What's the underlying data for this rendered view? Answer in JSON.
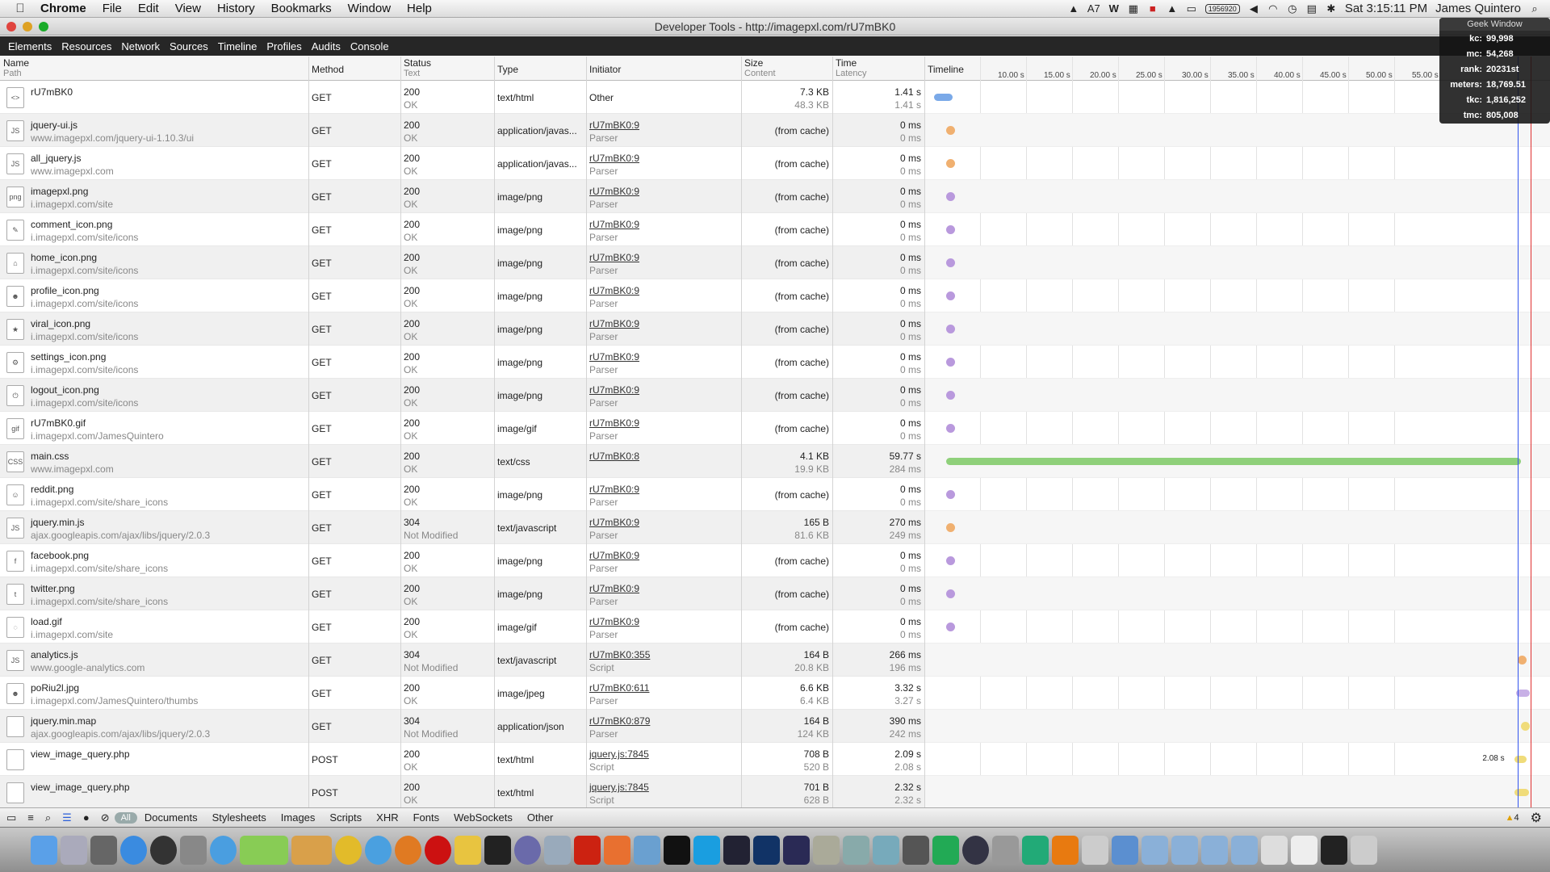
{
  "menubar": {
    "items": [
      "Chrome",
      "File",
      "Edit",
      "View",
      "History",
      "Bookmarks",
      "Window",
      "Help"
    ],
    "status": {
      "a_label": "7",
      "counter": "1956920",
      "datetime": "Sat 3:15:11 PM",
      "user": "James Quintero"
    }
  },
  "window": {
    "title": "Developer Tools - http://imagepxl.com/rU7mBK0"
  },
  "toolbar": {
    "tabs": [
      "Elements",
      "Resources",
      "Network",
      "Sources",
      "Timeline",
      "Profiles",
      "Audits",
      "Console"
    ]
  },
  "geek": {
    "title": "Geek Window",
    "rows": [
      {
        "k": "kc:",
        "v": "99,998"
      },
      {
        "k": "mc:",
        "v": "54,268"
      },
      {
        "k": "rank:",
        "v": "20231st"
      },
      {
        "k": "meters:",
        "v": "18,769.51"
      },
      {
        "k": "tkc:",
        "v": "1,816,252"
      },
      {
        "k": "tmc:",
        "v": "805,008"
      }
    ]
  },
  "columns": {
    "name": "Name",
    "name_sub": "Path",
    "method": "Method",
    "status": "Status",
    "status_sub": "Text",
    "type": "Type",
    "initiator": "Initiator",
    "size": "Size",
    "size_sub": "Content",
    "time": "Time",
    "time_sub": "Latency",
    "timeline": "Timeline"
  },
  "timeline_ticks": [
    "10.00 s",
    "15.00 s",
    "20.00 s",
    "25.00 s",
    "30.00 s",
    "35.00 s",
    "40.00 s",
    "45.00 s",
    "50.00 s",
    "55.00 s"
  ],
  "rows": [
    {
      "name": "rU7mBK0",
      "path": "",
      "method": "GET",
      "status": "200",
      "status_text": "OK",
      "type": "text/html",
      "initiator": "Other",
      "initiator_sub": "",
      "size": "7.3 KB",
      "content": "48.3 KB",
      "time": "1.41 s",
      "latency": "1.41 s",
      "icon": "html-file-icon",
      "icon_text": "<>",
      "bar": {
        "start": 0.01,
        "end": 0.04,
        "color": "#7aa9e8"
      }
    },
    {
      "name": "jquery-ui.js",
      "path": "www.imagepxl.com/jquery-ui-1.10.3/ui",
      "method": "GET",
      "status": "200",
      "status_text": "OK",
      "type": "application/javas...",
      "initiator": "rU7mBK0:9",
      "initiator_sub": "Parser",
      "size": "(from cache)",
      "content": "",
      "time": "0 ms",
      "latency": "0 ms",
      "icon": "js-file-icon",
      "icon_text": "JS",
      "dot": {
        "at": 0.03,
        "color": "#f0b070"
      }
    },
    {
      "name": "all_jquery.js",
      "path": "www.imagepxl.com",
      "method": "GET",
      "status": "200",
      "status_text": "OK",
      "type": "application/javas...",
      "initiator": "rU7mBK0:9",
      "initiator_sub": "Parser",
      "size": "(from cache)",
      "content": "",
      "time": "0 ms",
      "latency": "0 ms",
      "icon": "js-file-icon",
      "icon_text": "JS",
      "dot": {
        "at": 0.03,
        "color": "#f0b070"
      }
    },
    {
      "name": "imagepxl.png",
      "path": "i.imagepxl.com/site",
      "method": "GET",
      "status": "200",
      "status_text": "OK",
      "type": "image/png",
      "initiator": "rU7mBK0:9",
      "initiator_sub": "Parser",
      "size": "(from cache)",
      "content": "",
      "time": "0 ms",
      "latency": "0 ms",
      "icon": "png-file-icon",
      "icon_text": "png",
      "dot": {
        "at": 0.03,
        "color": "#b999dd"
      }
    },
    {
      "name": "comment_icon.png",
      "path": "i.imagepxl.com/site/icons",
      "method": "GET",
      "status": "200",
      "status_text": "OK",
      "type": "image/png",
      "initiator": "rU7mBK0:9",
      "initiator_sub": "Parser",
      "size": "(from cache)",
      "content": "",
      "time": "0 ms",
      "latency": "0 ms",
      "icon": "comment-icon",
      "icon_text": "✎",
      "dot": {
        "at": 0.03,
        "color": "#b999dd"
      }
    },
    {
      "name": "home_icon.png",
      "path": "i.imagepxl.com/site/icons",
      "method": "GET",
      "status": "200",
      "status_text": "OK",
      "type": "image/png",
      "initiator": "rU7mBK0:9",
      "initiator_sub": "Parser",
      "size": "(from cache)",
      "content": "",
      "time": "0 ms",
      "latency": "0 ms",
      "icon": "home-icon",
      "icon_text": "⌂",
      "dot": {
        "at": 0.03,
        "color": "#b999dd"
      }
    },
    {
      "name": "profile_icon.png",
      "path": "i.imagepxl.com/site/icons",
      "method": "GET",
      "status": "200",
      "status_text": "OK",
      "type": "image/png",
      "initiator": "rU7mBK0:9",
      "initiator_sub": "Parser",
      "size": "(from cache)",
      "content": "",
      "time": "0 ms",
      "latency": "0 ms",
      "icon": "profile-icon",
      "icon_text": "☻",
      "dot": {
        "at": 0.03,
        "color": "#b999dd"
      }
    },
    {
      "name": "viral_icon.png",
      "path": "i.imagepxl.com/site/icons",
      "method": "GET",
      "status": "200",
      "status_text": "OK",
      "type": "image/png",
      "initiator": "rU7mBK0:9",
      "initiator_sub": "Parser",
      "size": "(from cache)",
      "content": "",
      "time": "0 ms",
      "latency": "0 ms",
      "icon": "medal-icon",
      "icon_text": "★",
      "dot": {
        "at": 0.03,
        "color": "#b999dd"
      }
    },
    {
      "name": "settings_icon.png",
      "path": "i.imagepxl.com/site/icons",
      "method": "GET",
      "status": "200",
      "status_text": "OK",
      "type": "image/png",
      "initiator": "rU7mBK0:9",
      "initiator_sub": "Parser",
      "size": "(from cache)",
      "content": "",
      "time": "0 ms",
      "latency": "0 ms",
      "icon": "gear-icon",
      "icon_text": "⚙",
      "dot": {
        "at": 0.03,
        "color": "#b999dd"
      }
    },
    {
      "name": "logout_icon.png",
      "path": "i.imagepxl.com/site/icons",
      "method": "GET",
      "status": "200",
      "status_text": "OK",
      "type": "image/png",
      "initiator": "rU7mBK0:9",
      "initiator_sub": "Parser",
      "size": "(from cache)",
      "content": "",
      "time": "0 ms",
      "latency": "0 ms",
      "icon": "power-icon",
      "icon_text": "⏻",
      "dot": {
        "at": 0.03,
        "color": "#b999dd"
      }
    },
    {
      "name": "rU7mBK0.gif",
      "path": "i.imagepxl.com/JamesQuintero",
      "method": "GET",
      "status": "200",
      "status_text": "OK",
      "type": "image/gif",
      "initiator": "rU7mBK0:9",
      "initiator_sub": "Parser",
      "size": "(from cache)",
      "content": "",
      "time": "0 ms",
      "latency": "0 ms",
      "icon": "gif-file-icon",
      "icon_text": "gif",
      "dot": {
        "at": 0.03,
        "color": "#b999dd"
      }
    },
    {
      "name": "main.css",
      "path": "www.imagepxl.com",
      "method": "GET",
      "status": "200",
      "status_text": "OK",
      "type": "text/css",
      "initiator": "rU7mBK0:8",
      "initiator_sub": "",
      "size": "4.1 KB",
      "content": "19.9 KB",
      "time": "59.77 s",
      "latency": "284 ms",
      "icon": "css-file-icon",
      "icon_text": "CSS",
      "bar": {
        "start": 0.03,
        "end": 0.985,
        "color": "#8fd07a"
      }
    },
    {
      "name": "reddit.png",
      "path": "i.imagepxl.com/site/share_icons",
      "method": "GET",
      "status": "200",
      "status_text": "OK",
      "type": "image/png",
      "initiator": "rU7mBK0:9",
      "initiator_sub": "Parser",
      "size": "(from cache)",
      "content": "",
      "time": "0 ms",
      "latency": "0 ms",
      "icon": "reddit-icon",
      "icon_text": "☺",
      "dot": {
        "at": 0.03,
        "color": "#b999dd"
      }
    },
    {
      "name": "jquery.min.js",
      "path": "ajax.googleapis.com/ajax/libs/jquery/2.0.3",
      "method": "GET",
      "status": "304",
      "status_text": "Not Modified",
      "type": "text/javascript",
      "initiator": "rU7mBK0:9",
      "initiator_sub": "Parser",
      "size": "165 B",
      "content": "81.6 KB",
      "time": "270 ms",
      "latency": "249 ms",
      "icon": "js-file-icon",
      "icon_text": "JS",
      "dot": {
        "at": 0.03,
        "color": "#f0b070"
      }
    },
    {
      "name": "facebook.png",
      "path": "i.imagepxl.com/site/share_icons",
      "method": "GET",
      "status": "200",
      "status_text": "OK",
      "type": "image/png",
      "initiator": "rU7mBK0:9",
      "initiator_sub": "Parser",
      "size": "(from cache)",
      "content": "",
      "time": "0 ms",
      "latency": "0 ms",
      "icon": "facebook-icon",
      "icon_text": "f",
      "dot": {
        "at": 0.03,
        "color": "#b999dd"
      }
    },
    {
      "name": "twitter.png",
      "path": "i.imagepxl.com/site/share_icons",
      "method": "GET",
      "status": "200",
      "status_text": "OK",
      "type": "image/png",
      "initiator": "rU7mBK0:9",
      "initiator_sub": "Parser",
      "size": "(from cache)",
      "content": "",
      "time": "0 ms",
      "latency": "0 ms",
      "icon": "twitter-icon",
      "icon_text": "t",
      "dot": {
        "at": 0.03,
        "color": "#b999dd"
      }
    },
    {
      "name": "load.gif",
      "path": "i.imagepxl.com/site",
      "method": "GET",
      "status": "200",
      "status_text": "OK",
      "type": "image/gif",
      "initiator": "rU7mBK0:9",
      "initiator_sub": "Parser",
      "size": "(from cache)",
      "content": "",
      "time": "0 ms",
      "latency": "0 ms",
      "icon": "spinner-icon",
      "icon_text": "◌",
      "dot": {
        "at": 0.03,
        "color": "#b999dd"
      }
    },
    {
      "name": "analytics.js",
      "path": "www.google-analytics.com",
      "method": "GET",
      "status": "304",
      "status_text": "Not Modified",
      "type": "text/javascript",
      "initiator": "rU7mBK0:355",
      "initiator_sub": "Script",
      "size": "164 B",
      "content": "20.8 KB",
      "time": "266 ms",
      "latency": "196 ms",
      "icon": "js-file-icon",
      "icon_text": "JS",
      "dot": {
        "at": 0.98,
        "color": "#f0b070"
      }
    },
    {
      "name": "poRiu2l.jpg",
      "path": "i.imagepxl.com/JamesQuintero/thumbs",
      "method": "GET",
      "status": "200",
      "status_text": "OK",
      "type": "image/jpeg",
      "initiator": "rU7mBK0:611",
      "initiator_sub": "Parser",
      "size": "6.6 KB",
      "content": "6.4 KB",
      "time": "3.32 s",
      "latency": "3.27 s",
      "icon": "photo-thumbnail-icon",
      "icon_text": "☻",
      "bar": {
        "start": 0.977,
        "end": 1.0,
        "color": "#c8b0e6"
      }
    },
    {
      "name": "jquery.min.map",
      "path": "ajax.googleapis.com/ajax/libs/jquery/2.0.3",
      "method": "GET",
      "status": "304",
      "status_text": "Not Modified",
      "type": "application/json",
      "initiator": "rU7mBK0:879",
      "initiator_sub": "Parser",
      "size": "164 B",
      "content": "124 KB",
      "time": "390 ms",
      "latency": "242 ms",
      "icon": "blank-file-icon",
      "icon_text": "",
      "dot": {
        "at": 0.985,
        "color": "#f0dc7a"
      }
    },
    {
      "name": "view_image_query.php",
      "path": "",
      "method": "POST",
      "status": "200",
      "status_text": "OK",
      "type": "text/html",
      "initiator": "jquery.js:7845",
      "initiator_sub": "Script",
      "size": "708 B",
      "content": "520 B",
      "time": "2.09 s",
      "latency": "2.08 s",
      "icon": "blank-file-icon",
      "icon_text": "",
      "bar": {
        "start": 0.975,
        "end": 0.995,
        "color": "#f0dc7a"
      },
      "bar_label": "2.08 s"
    },
    {
      "name": "view_image_query.php",
      "path": "",
      "method": "POST",
      "status": "200",
      "status_text": "OK",
      "type": "text/html",
      "initiator": "jquery.js:7845",
      "initiator_sub": "Script",
      "size": "701 B",
      "content": "628 B",
      "time": "2.32 s",
      "latency": "2.32 s",
      "icon": "blank-file-icon",
      "icon_text": "",
      "bar": {
        "start": 0.975,
        "end": 0.998,
        "color": "#f0dc7a"
      }
    }
  ],
  "bottombar": {
    "filters": [
      "All",
      "Documents",
      "Stylesheets",
      "Images",
      "Scripts",
      "XHR",
      "Fonts",
      "WebSockets",
      "Other"
    ],
    "warnings": "4"
  },
  "colors": {
    "toolbar_bg": "#262626",
    "dom_line": "#3355ee",
    "load_line": "#e03030"
  }
}
